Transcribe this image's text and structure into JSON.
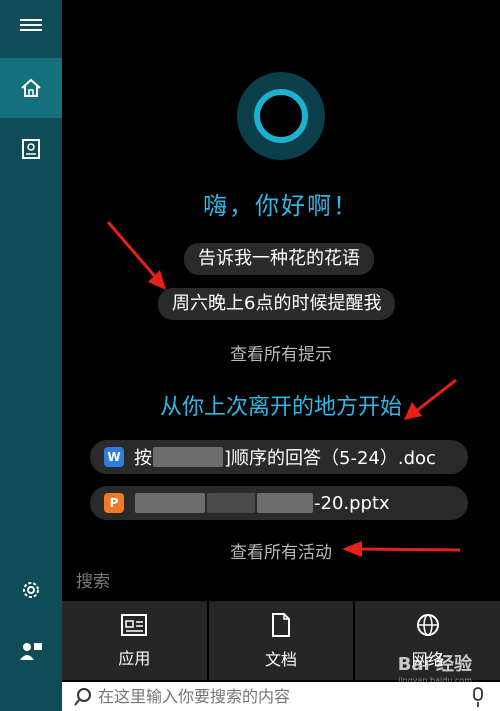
{
  "sidebar": {
    "items": [
      {
        "icon": "hamburger-menu-icon"
      },
      {
        "icon": "home-icon",
        "active": true
      },
      {
        "icon": "notebook-icon"
      },
      {
        "icon": "gear-icon"
      },
      {
        "icon": "feedback-icon"
      }
    ]
  },
  "cortana": {
    "greeting": "嗨，你好啊！",
    "suggestions": [
      "告诉我一种花的花语",
      "周六晚上6点的时候提醒我"
    ],
    "see_all_tips": "查看所有提示"
  },
  "activity": {
    "title": "从你上次离开的地方开始",
    "files": [
      {
        "icon_text": "W",
        "icon_color": "#2f7de1",
        "prefix": "按",
        "suffix": "]顺序的回答（5-24）.doc"
      },
      {
        "icon_text": "P",
        "icon_color": "#f07a2a",
        "prefix": "",
        "suffix": "-20.pptx"
      }
    ],
    "see_all_activity": "查看所有活动"
  },
  "search": {
    "label": "搜索",
    "tiles": [
      {
        "label": "应用",
        "icon": "apps-icon"
      },
      {
        "label": "文档",
        "icon": "document-icon"
      },
      {
        "label": "网络",
        "icon": "globe-icon"
      }
    ],
    "placeholder": "在这里输入你要搜索的内容"
  },
  "colors": {
    "accent": "#2eb8e6",
    "sidebar": "#0e4d57",
    "sidebar_active": "#14707d",
    "arrow": "#e8201a"
  },
  "watermark": {
    "text": "Bai 经验",
    "sub": "jingyan.baidu.com"
  }
}
